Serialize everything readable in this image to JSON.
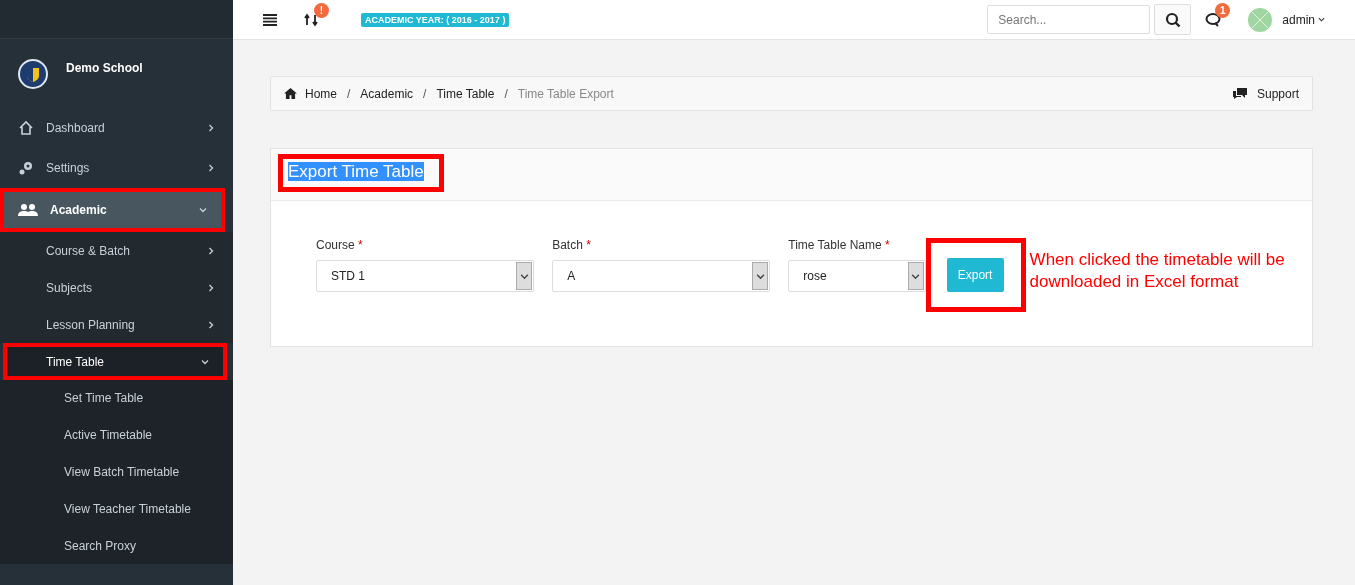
{
  "topbar": {
    "sync_badge": "!",
    "academic_year": "ACADEMIC YEAR: ( 2016 - 2017 )",
    "search": {
      "placeholder": "Search..."
    },
    "messages_badge": "1",
    "user": "admin"
  },
  "sidebar": {
    "school": "Demo School",
    "items": [
      {
        "label": "Dashboard",
        "active": false,
        "expanded": false,
        "annotated": false
      },
      {
        "label": "Settings",
        "active": false,
        "expanded": false,
        "annotated": false
      },
      {
        "label": "Academic",
        "active": true,
        "expanded": true,
        "annotated": true,
        "children": [
          {
            "label": "Course & Batch",
            "active": false,
            "expanded": false,
            "annotated": false
          },
          {
            "label": "Subjects",
            "active": false,
            "expanded": false,
            "annotated": false
          },
          {
            "label": "Lesson Planning",
            "active": false,
            "expanded": false,
            "annotated": false
          },
          {
            "label": "Time Table",
            "active": true,
            "expanded": true,
            "annotated": true,
            "children": [
              {
                "label": "Set Time Table"
              },
              {
                "label": "Active Timetable"
              },
              {
                "label": "View Batch Timetable"
              },
              {
                "label": "View Teacher Timetable"
              },
              {
                "label": "Search Proxy"
              }
            ]
          }
        ]
      }
    ]
  },
  "breadcrumb": [
    {
      "label": "Home",
      "current": false
    },
    {
      "separator": "/",
      "label": "Academic",
      "current": false
    },
    {
      "separator": "/",
      "label": "Time Table",
      "current": false
    },
    {
      "separator": "/",
      "label": "Time Table Export",
      "current": true
    }
  ],
  "support": "Support",
  "card": {
    "title": "Export Time Table",
    "title_selected": true,
    "title_annotated": true,
    "fields": [
      {
        "label": "Course",
        "required": "*",
        "value": "STD 1"
      },
      {
        "label": "Batch",
        "required": "*",
        "value": "A"
      },
      {
        "label": "Time Table Name",
        "required": "*",
        "value": "rose"
      }
    ],
    "button": {
      "label": "Export",
      "annotated": true
    }
  },
  "annotation": "When clicked the timetable will be downloaded in Excel format"
}
